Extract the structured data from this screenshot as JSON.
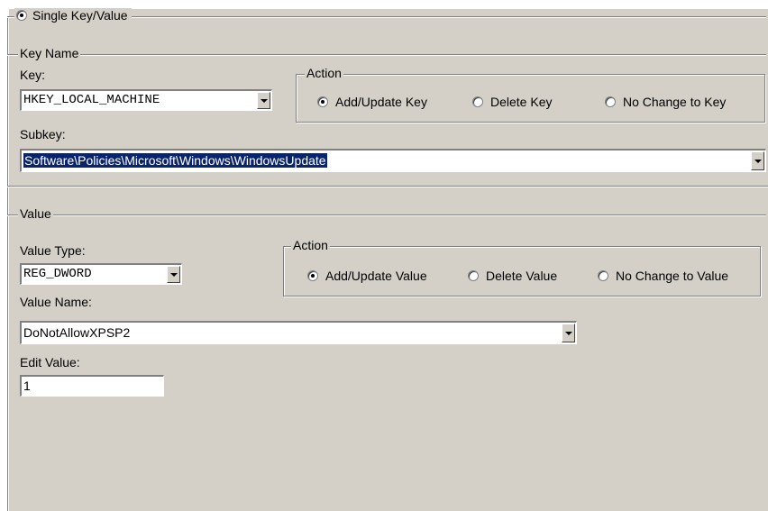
{
  "single_key_value_label": "Single Key/Value",
  "key_name": {
    "legend": "Key Name",
    "key_label": "Key:",
    "key_value": "HKEY_LOCAL_MACHINE",
    "subkey_label": "Subkey:",
    "subkey_value": "Software\\Policies\\Microsoft\\Windows\\WindowsUpdate",
    "action": {
      "legend": "Action",
      "options": [
        "Add/Update Key",
        "Delete Key",
        "No Change to Key"
      ],
      "selected": "Add/Update Key"
    }
  },
  "value": {
    "legend": "Value",
    "type_label": "Value Type:",
    "type_value": "REG_DWORD",
    "name_label": "Value Name:",
    "name_value": "DoNotAllowXPSP2",
    "edit_label": "Edit Value:",
    "edit_value": "1",
    "action": {
      "legend": "Action",
      "options": [
        "Add/Update Value",
        "Delete Value",
        "No Change to Value"
      ],
      "selected": "Add/Update Value"
    }
  }
}
